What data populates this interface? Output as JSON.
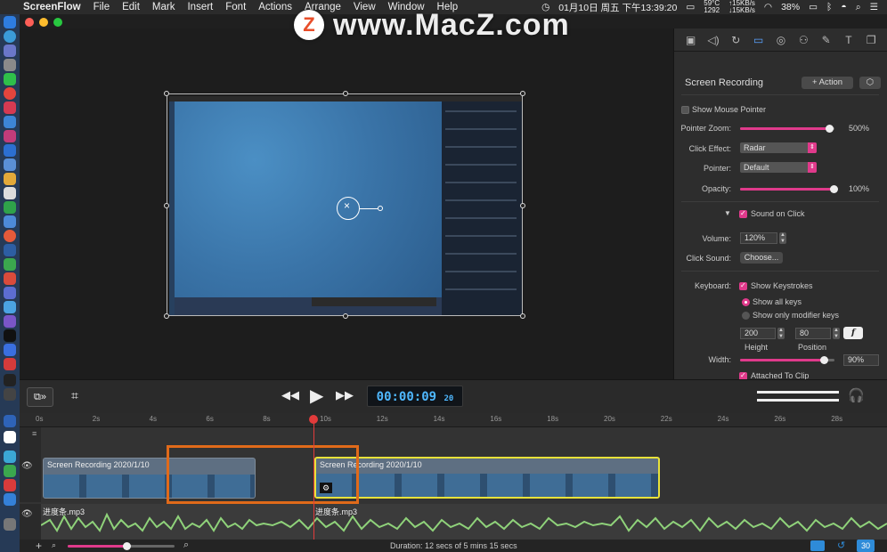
{
  "menubar": {
    "app": "ScreenFlow",
    "items": [
      "File",
      "Edit",
      "Mark",
      "Insert",
      "Font",
      "Actions",
      "Arrange",
      "View",
      "Window",
      "Help"
    ],
    "clock": "01月10日 周五 下午13:39:20",
    "temp": "59°C",
    "cpu": "1292",
    "net_up": "↑15KB/s",
    "net_down": "↓15KB/s",
    "battery": "38%"
  },
  "watermark": {
    "logo": "Z",
    "text": "www.MacZ.com"
  },
  "inspector": {
    "section_title": "Screen Recording",
    "add_action": "+ Action",
    "show_mouse_pointer": "Show Mouse Pointer",
    "pointer_zoom_label": "Pointer Zoom:",
    "pointer_zoom_value": "500%",
    "pointer_zoom_level": 0.95,
    "click_effect_label": "Click Effect:",
    "click_effect_value": "Radar",
    "pointer_label": "Pointer:",
    "pointer_value": "Default",
    "opacity_label": "Opacity:",
    "opacity_value": "100%",
    "opacity_level": 1.0,
    "sound_on_click": "Sound on Click",
    "volume_label": "Volume:",
    "volume_value": "120%",
    "click_sound_label": "Click Sound:",
    "choose_button": "Choose...",
    "keyboard_label": "Keyboard:",
    "show_keystrokes": "Show Keystrokes",
    "show_all_keys": "Show all keys",
    "show_modifier_keys": "Show only modifier keys",
    "height_value": "200",
    "position_value": "80",
    "height_label": "Height",
    "position_label": "Position",
    "font_button": "f",
    "width_label": "Width:",
    "width_value": "90%",
    "width_level": 0.9,
    "attached_to_clip": "Attached To Clip"
  },
  "transport": {
    "timecode": "00:00:09",
    "frames": "20"
  },
  "ruler": {
    "labels": [
      "0s",
      "2s",
      "4s",
      "6s",
      "8s",
      "10s",
      "12s",
      "14s",
      "16s",
      "18s",
      "20s",
      "22s",
      "24s",
      "26s",
      "28s"
    ]
  },
  "timeline": {
    "clip1_title": "Screen Recording 2020/1/10",
    "clip2_title": "Screen Recording 2020/1/10",
    "audio1_title": "进度条.mp3",
    "audio2_title": "进度条.mp3"
  },
  "status": {
    "duration": "Duration: 12 secs of 5 mins 15 secs",
    "count": "30"
  },
  "colors": {
    "accent": "#e03a8b",
    "timecode": "#4fb8ff",
    "selection": "#e06a1a",
    "clip_selected": "#e8e23a",
    "waveform": "#8fd27a"
  }
}
